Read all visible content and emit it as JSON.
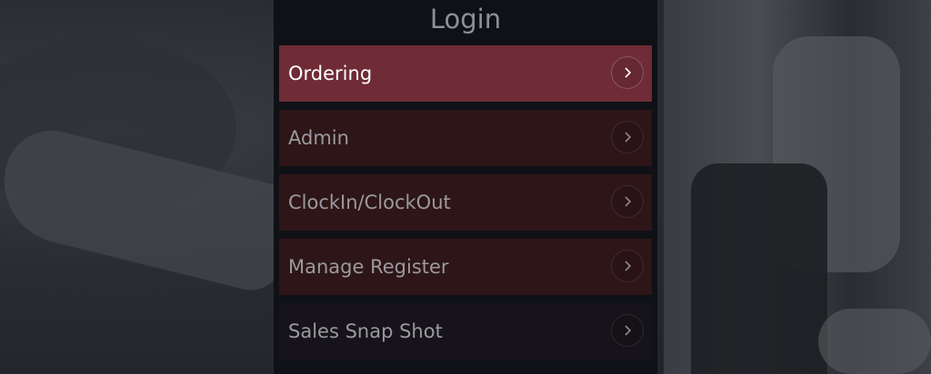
{
  "login": {
    "title": "Login",
    "items": [
      {
        "label": "Ordering",
        "icon": "chevron-right-icon",
        "active": true
      },
      {
        "label": "Admin",
        "icon": "chevron-right-icon",
        "active": false
      },
      {
        "label": "ClockIn/ClockOut",
        "icon": "chevron-right-icon",
        "active": false
      },
      {
        "label": "Manage Register",
        "icon": "chevron-right-icon",
        "active": false
      },
      {
        "label": "Sales Snap Shot",
        "icon": "chevron-right-icon",
        "active": false
      }
    ]
  },
  "colors": {
    "panel": "#0f1116",
    "active_item": "#6f2c36",
    "item": "#2e1518"
  }
}
